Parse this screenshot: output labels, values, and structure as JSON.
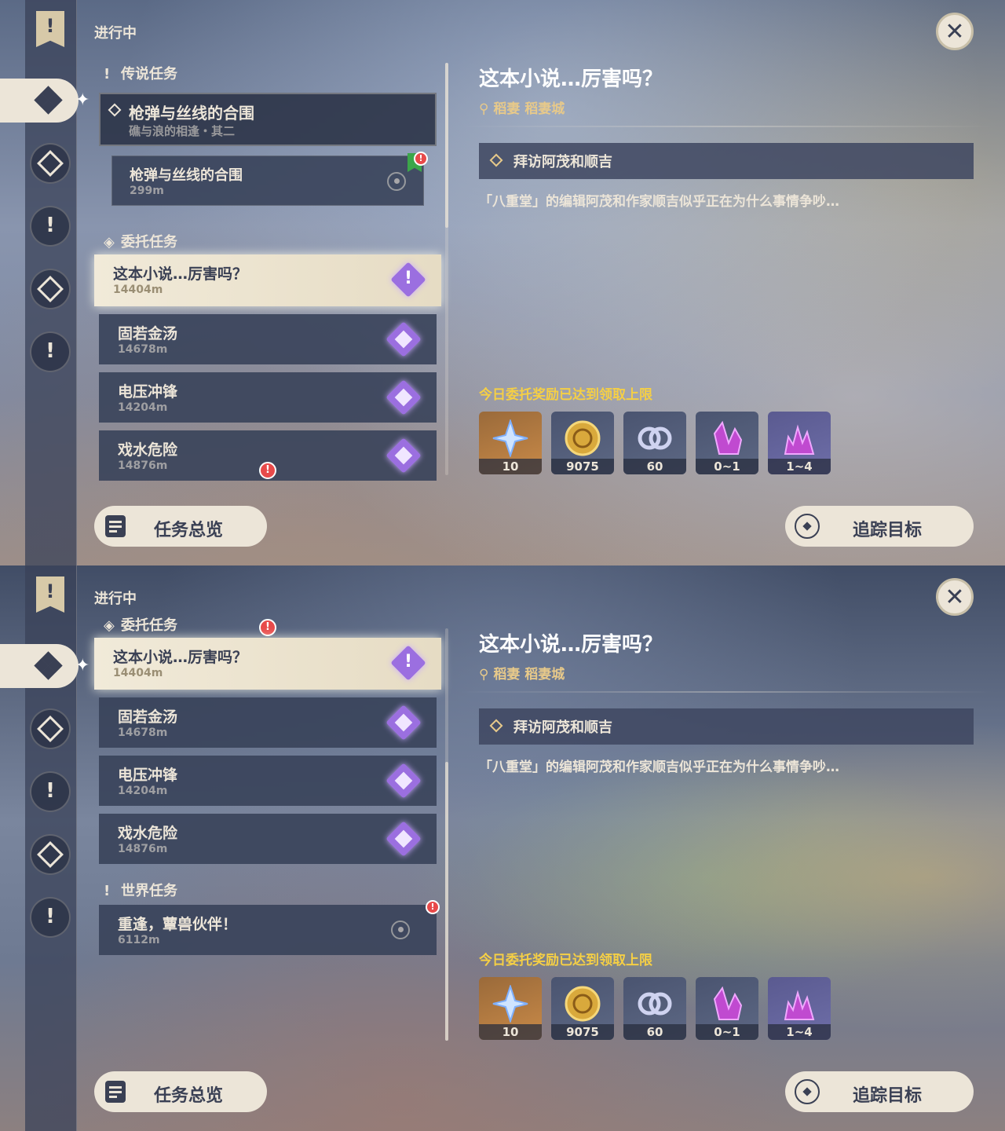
{
  "panel1": {
    "status": "进行中",
    "legendary": {
      "header": "传说任务",
      "title": "枪弹与丝线的合围",
      "subtitle": "礁与浪的相逢・其二",
      "sub_title": "枪弹与丝线的合围",
      "sub_dist": "299m"
    },
    "commission_header": "委托任务",
    "commissions": [
      {
        "title": "这本小说…厉害吗？",
        "dist": "14404m"
      },
      {
        "title": "固若金汤",
        "dist": "14678m"
      },
      {
        "title": "电压冲锋",
        "dist": "14204m"
      },
      {
        "title": "戏水危险",
        "dist": "14876m"
      }
    ]
  },
  "panel2": {
    "status": "进行中",
    "commission_header": "委托任务",
    "commissions": [
      {
        "title": "这本小说…厉害吗？",
        "dist": "14404m"
      },
      {
        "title": "固若金汤",
        "dist": "14678m"
      },
      {
        "title": "电压冲锋",
        "dist": "14204m"
      },
      {
        "title": "戏水危险",
        "dist": "14876m"
      }
    ],
    "world_header": "世界任务",
    "world": [
      {
        "title": "重逢，蕈兽伙伴！",
        "dist": "6112m"
      }
    ]
  },
  "detail": {
    "title": "这本小说…厉害吗？",
    "location": "稻妻 稻妻城",
    "step": "拜访阿茂和顺吉",
    "description": "「八重堂」的编辑阿茂和作家顺吉似乎正在为什么事情争吵…",
    "reward_note": "今日委托奖励已达到领取上限",
    "rewards": [
      {
        "icon": "primogem-icon",
        "count": "10"
      },
      {
        "icon": "mora-icon",
        "count": "9075"
      },
      {
        "icon": "companionship-exp-icon",
        "count": "60"
      },
      {
        "icon": "crystal-chunk-icon",
        "count": "0~1"
      },
      {
        "icon": "crystal-cluster-icon",
        "count": "1~4"
      }
    ]
  },
  "buttons": {
    "overview": "任务总览",
    "track": "追踪目标"
  },
  "icons": {
    "close": "close-icon",
    "quest_nav": "quest-ribbon-icon"
  },
  "colors": {
    "accent": "#ece5d8",
    "gold": "#e7c98a",
    "warning_yellow": "#f5cf45",
    "commission_purple": "#9b6fe0",
    "alert_red": "#e84a4a"
  }
}
